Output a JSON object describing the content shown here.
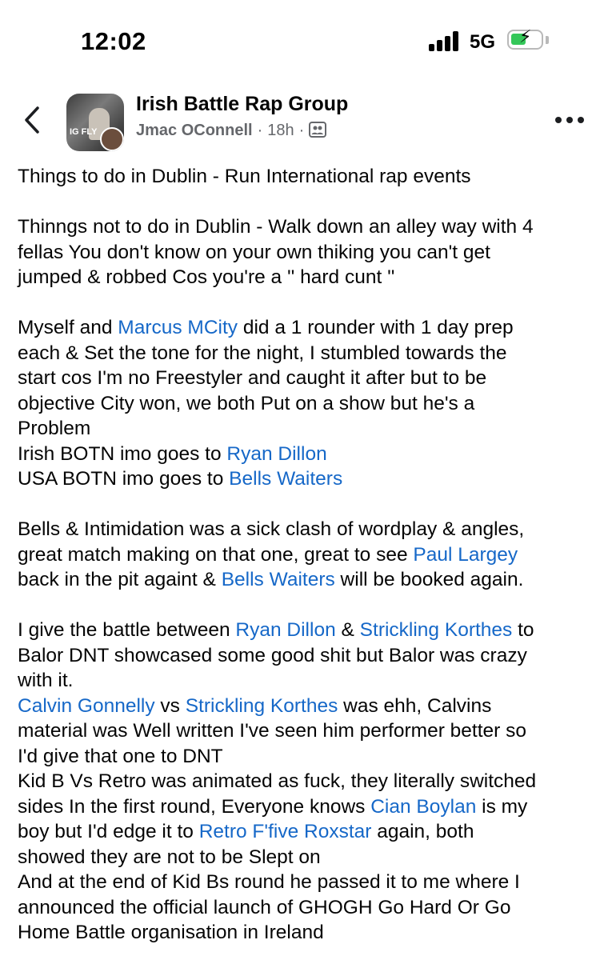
{
  "status_bar": {
    "time": "12:02",
    "network": "5G"
  },
  "header": {
    "group_name": "Irish Battle Rap Group",
    "author": "Jmac OConnell",
    "time_ago": "18h",
    "separator": "·"
  },
  "post": {
    "p1": "Things to do in Dublin - Run International rap events",
    "p2_l1": "Thinngs not to do in Dublin - Walk down an alley way with 4",
    "p2_l2": "fellas You don't know on your own thiking you can't get",
    "p2_l3": "jumped & robbed Cos you're a '' hard cunt ''",
    "p3_l1_a": "Myself and ",
    "m_marcus": "Marcus MCity",
    "p3_l1_b": " did a 1 rounder with 1 day prep",
    "p3_l2": "each & Set the tone for the night, I stumbled towards the",
    "p3_l3": "start cos I'm no Freestyler and caught it after but to be",
    "p3_l4": "objective City won, we both Put on a show but he's a",
    "p3_l5": "Problem",
    "irish_botn": "Irish BOTN imo goes to ",
    "m_ryan": "Ryan Dillon",
    "usa_botn": "USA BOTN imo goes to ",
    "m_bells": "Bells Waiters",
    "p4_l1": "Bells & Intimidation was a sick clash of wordplay & angles,",
    "p4_l2_a": "great match making on that one, great to see ",
    "m_paul": "Paul Largey",
    "p4_l3_a": "back in the pit againt & ",
    "p4_l3_b": " will be booked again.",
    "p5_l1_a": "I give the battle between ",
    "p5_amp": " & ",
    "m_strickling": "Strickling Korthes",
    "p5_l1_b": " to",
    "p5_l2": "Balor DNT showcased some good shit but Balor was crazy",
    "p5_l3": "with it.",
    "m_calvin": "Calvin Gonnelly",
    "p6_vs": " vs ",
    "p6_l1_b": " was ehh, Calvins",
    "p6_l2": "material was Well written I've seen him performer better so",
    "p6_l3": "I'd give that one to DNT",
    "p7_l1": "Kid B Vs Retro was animated as fuck, they literally switched",
    "p7_l2_a": "sides In the first round, Everyone knows ",
    "m_cian": "Cian Boylan",
    "p7_l2_b": " is my",
    "p7_l3_a": "boy but I'd edge it to ",
    "m_retro": "Retro F'five Roxstar",
    "p7_l3_b": " again, both",
    "p7_l4": "showed they are not to be Slept on",
    "p8_l1": "And at the end of Kid Bs round he passed it to me where I",
    "p8_l2": "announced the official launch of GHOGH Go Hard Or Go",
    "p8_l3": "Home Battle organisation in Ireland"
  },
  "colors": {
    "mention": "#1668c8",
    "secondary_text": "#65676b",
    "battery": "#34c759"
  },
  "icons": [
    "back-chevron-icon",
    "group-members-icon",
    "more-dots-icon",
    "signal-icon",
    "battery-charging-icon"
  ]
}
